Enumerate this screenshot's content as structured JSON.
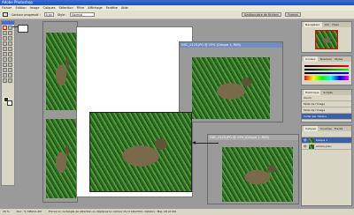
{
  "window": {
    "title": "Adobe Photoshop"
  },
  "menu": [
    "Fichier",
    "Edition",
    "Image",
    "Calques",
    "Sélection",
    "Filtre",
    "Affichage",
    "Fenêtre",
    "Aide"
  ],
  "options": {
    "feather_label": "Contour progressif :",
    "feather_value": "0 px",
    "style_label": "Style :",
    "style_value": "Normal",
    "palette_btn": "Gestionnaire de fichiers",
    "tab_label": "Formes"
  },
  "documents": {
    "front_title": "DSC_0123.JPG @ 25% (Calque 1, RVB)",
    "back_title": "DSC_0123.JPG @ 25% (Calque 1, RVB)"
  },
  "panels": {
    "navigator_tabs": [
      "Navigateur",
      "Info",
      "Histo"
    ],
    "color_tabs": [
      "Couleur",
      "Nuancier",
      "Styles"
    ],
    "history_tabs": [
      "Historique",
      "Scripts"
    ],
    "history_items": [
      "Ouvrir",
      "Taille de l'image",
      "Taille de l'image",
      "Coller par dessus"
    ],
    "layers_tabs": [
      "Calques",
      "Couches",
      "Tracés"
    ],
    "layers": [
      "Calque 1",
      "Arrière-plan"
    ]
  },
  "status": {
    "zoom": "25 %",
    "doc": "Doc : 5,74M/11,4M",
    "hint": "Tracez un rectangle de sélection ou déplacez le contour de la sélection. Options : Maj, Alt et Ctrl."
  },
  "colors": {
    "title_active": "#6f8fc0",
    "ui_gray": "#d9d6c6"
  }
}
